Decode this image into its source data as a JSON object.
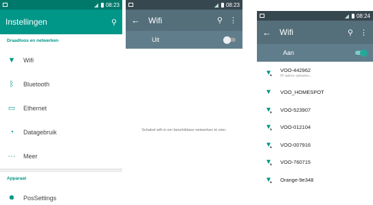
{
  "screen1": {
    "status_time": "08:23",
    "title": "Instellingen",
    "section_wireless": "Draadloos en netwerken",
    "items": [
      {
        "label": "Wifi",
        "icon": "wifi-icon"
      },
      {
        "label": "Bluetooth",
        "icon": "bluetooth-icon"
      },
      {
        "label": "Ethernet",
        "icon": "monitor-icon"
      },
      {
        "label": "Datagebruik",
        "icon": "data-usage-icon"
      },
      {
        "label": "Meer",
        "icon": "more-dots-icon"
      }
    ],
    "section_device": "Apparaat",
    "device_items": [
      {
        "label": "PosSettings",
        "icon": "gear-icon"
      }
    ]
  },
  "screen2": {
    "status_time": "08:23",
    "title": "Wifi",
    "switch_label": "Uit",
    "empty_message": "Schakel wifi in om beschikbare netwerken te zien."
  },
  "screen3": {
    "status_time": "08:24",
    "title": "Wifi",
    "switch_label": "Aan",
    "networks": [
      {
        "ssid": "VOO-442962",
        "status": "IP-adres ophalen...",
        "locked": true
      },
      {
        "ssid": "VOO_HOMESPOT",
        "status": "",
        "locked": false
      },
      {
        "ssid": "VOO-523907",
        "status": "",
        "locked": true
      },
      {
        "ssid": "VOO-012104",
        "status": "",
        "locked": true
      },
      {
        "ssid": "VOO-007916",
        "status": "",
        "locked": true
      },
      {
        "ssid": "VOO-760715",
        "status": "",
        "locked": true
      },
      {
        "ssid": "Orange-9e348",
        "status": "",
        "locked": true
      }
    ]
  },
  "colors": {
    "teal_primary": "#009688",
    "teal_dark": "#00796b",
    "bluegrey_bar": "#546e7a",
    "bluegrey_switch": "#607d8b"
  }
}
